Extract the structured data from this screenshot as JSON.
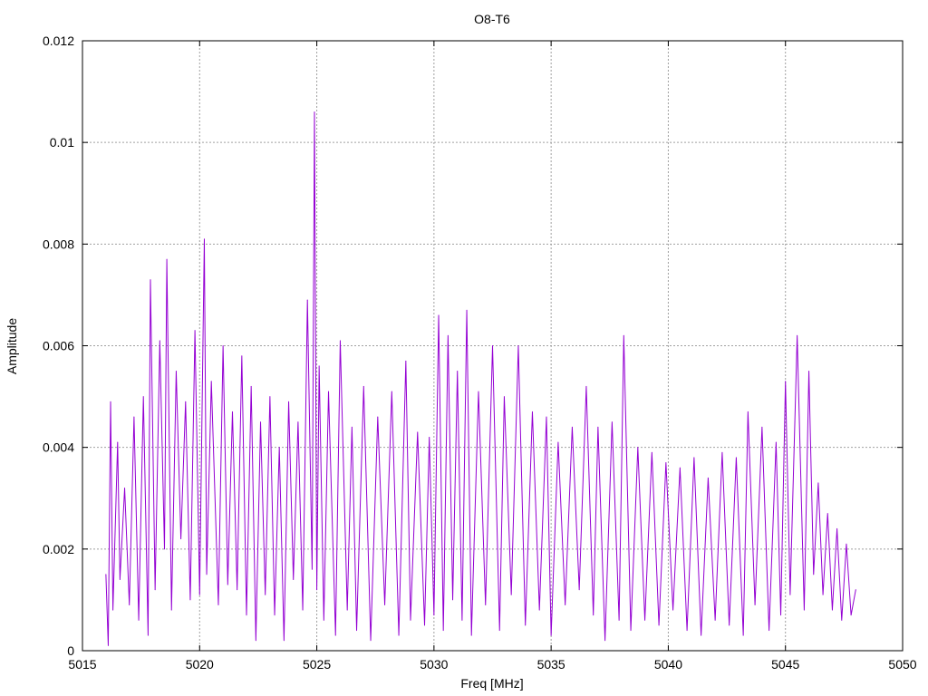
{
  "chart_data": {
    "type": "line",
    "title": "O8-T6",
    "xlabel": "Freq [MHz]",
    "ylabel": "Amplitude",
    "xlim": [
      5015,
      5050
    ],
    "ylim": [
      0,
      0.012
    ],
    "xticks": [
      5015,
      5020,
      5025,
      5030,
      5035,
      5040,
      5045,
      5050
    ],
    "xtick_labels": [
      "5015",
      "5020",
      "5025",
      "5030",
      "5035",
      "5040",
      "5045",
      "5050"
    ],
    "yticks": [
      0,
      0.002,
      0.004,
      0.006,
      0.008,
      0.01,
      0.012
    ],
    "ytick_labels": [
      "0",
      "0.002",
      "0.004",
      "0.006",
      "0.008",
      "0.01",
      "0.012"
    ],
    "grid": true,
    "series": [
      {
        "color": "#9400d3",
        "x": [
          5016.0,
          5016.1,
          5016.2,
          5016.3,
          5016.5,
          5016.6,
          5016.8,
          5017.0,
          5017.2,
          5017.4,
          5017.6,
          5017.8,
          5017.9,
          5018.1,
          5018.3,
          5018.5,
          5018.6,
          5018.8,
          5019.0,
          5019.2,
          5019.4,
          5019.6,
          5019.8,
          5020.0,
          5020.2,
          5020.3,
          5020.5,
          5020.8,
          5021.0,
          5021.2,
          5021.4,
          5021.6,
          5021.8,
          5022.0,
          5022.2,
          5022.4,
          5022.6,
          5022.8,
          5023.0,
          5023.2,
          5023.4,
          5023.6,
          5023.8,
          5024.0,
          5024.2,
          5024.4,
          5024.6,
          5024.8,
          5024.9,
          5025.0,
          5025.1,
          5025.3,
          5025.5,
          5025.8,
          5026.0,
          5026.3,
          5026.5,
          5026.7,
          5027.0,
          5027.3,
          5027.6,
          5027.9,
          5028.2,
          5028.5,
          5028.8,
          5029.0,
          5029.3,
          5029.6,
          5029.8,
          5030.0,
          5030.2,
          5030.4,
          5030.6,
          5030.8,
          5031.0,
          5031.2,
          5031.4,
          5031.6,
          5031.9,
          5032.2,
          5032.5,
          5032.8,
          5033.0,
          5033.3,
          5033.6,
          5033.9,
          5034.2,
          5034.5,
          5034.8,
          5035.0,
          5035.3,
          5035.6,
          5035.9,
          5036.2,
          5036.5,
          5036.8,
          5037.0,
          5037.3,
          5037.6,
          5037.9,
          5038.1,
          5038.4,
          5038.7,
          5039.0,
          5039.3,
          5039.6,
          5039.9,
          5040.2,
          5040.5,
          5040.8,
          5041.1,
          5041.4,
          5041.7,
          5042.0,
          5042.3,
          5042.6,
          5042.9,
          5043.2,
          5043.4,
          5043.7,
          5044.0,
          5044.3,
          5044.6,
          5044.8,
          5045.0,
          5045.2,
          5045.5,
          5045.8,
          5046.0,
          5046.2,
          5046.4,
          5046.6,
          5046.8,
          5047.0,
          5047.2,
          5047.4,
          5047.6,
          5047.8,
          5048.0
        ],
        "y": [
          0.0015,
          0.0001,
          0.0049,
          0.0008,
          0.0041,
          0.0014,
          0.0032,
          0.0009,
          0.0046,
          0.0006,
          0.005,
          0.0003,
          0.0073,
          0.0012,
          0.0061,
          0.002,
          0.0077,
          0.0008,
          0.0055,
          0.0022,
          0.0049,
          0.001,
          0.0063,
          0.0011,
          0.0081,
          0.0015,
          0.0053,
          0.0009,
          0.006,
          0.0013,
          0.0047,
          0.0012,
          0.0058,
          0.0007,
          0.0052,
          0.0002,
          0.0045,
          0.0011,
          0.005,
          0.0007,
          0.004,
          0.0002,
          0.0049,
          0.0014,
          0.0045,
          0.0008,
          0.0069,
          0.0016,
          0.0106,
          0.0012,
          0.0056,
          0.0006,
          0.0051,
          0.0003,
          0.0061,
          0.0008,
          0.0044,
          0.0004,
          0.0052,
          0.0002,
          0.0046,
          0.0009,
          0.0051,
          0.0003,
          0.0057,
          0.0006,
          0.0043,
          0.0005,
          0.0042,
          0.0007,
          0.0066,
          0.0004,
          0.0062,
          0.001,
          0.0055,
          0.0006,
          0.0067,
          0.0003,
          0.0051,
          0.0009,
          0.006,
          0.0004,
          0.005,
          0.0011,
          0.006,
          0.0005,
          0.0047,
          0.0008,
          0.0046,
          0.0003,
          0.0041,
          0.0009,
          0.0044,
          0.0012,
          0.0052,
          0.0007,
          0.0044,
          0.0002,
          0.0045,
          0.0006,
          0.0062,
          0.0004,
          0.004,
          0.0006,
          0.0039,
          0.0005,
          0.0037,
          0.0008,
          0.0036,
          0.0004,
          0.0038,
          0.0003,
          0.0034,
          0.0006,
          0.0039,
          0.0005,
          0.0038,
          0.0003,
          0.0047,
          0.0009,
          0.0044,
          0.0004,
          0.0041,
          0.0007,
          0.0053,
          0.0011,
          0.0062,
          0.0008,
          0.0055,
          0.0015,
          0.0033,
          0.0011,
          0.0027,
          0.0008,
          0.0024,
          0.0006,
          0.0021,
          0.0007,
          0.0012
        ]
      }
    ]
  }
}
